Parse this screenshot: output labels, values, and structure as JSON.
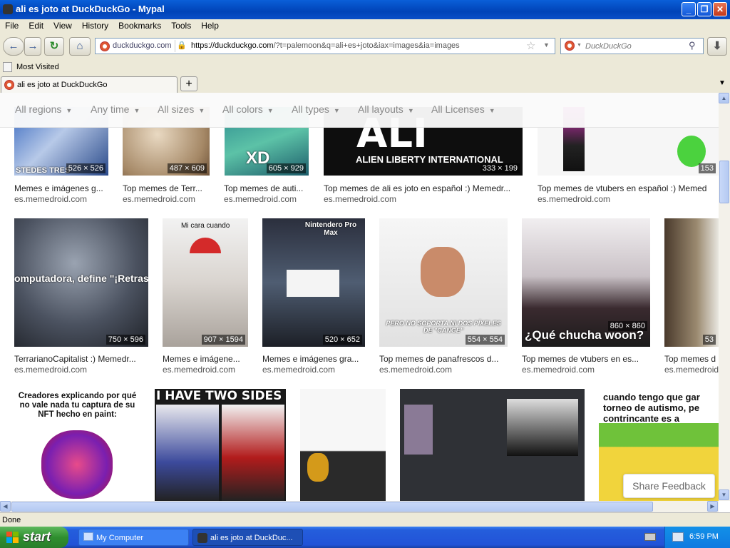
{
  "window": {
    "title": "ali es joto at DuckDuckGo - Mypal"
  },
  "menu": [
    "File",
    "Edit",
    "View",
    "History",
    "Bookmarks",
    "Tools",
    "Help"
  ],
  "nav": {
    "site_identity": "duckduckgo.com",
    "url_host": "https://duckduckgo.com",
    "url_rest": "/?t=palemoon&q=ali+es+joto&iax=images&ia=images",
    "search_placeholder": "DuckDuckGo"
  },
  "bookmarks": {
    "most_visited": "Most Visited"
  },
  "tab": {
    "title": "ali es joto at DuckDuckGo",
    "new_tab": "+"
  },
  "filters": [
    "All regions",
    "Any time",
    "All sizes",
    "All colors",
    "All types",
    "All layouts",
    "All Licenses"
  ],
  "results": {
    "row1": [
      {
        "caption": "Memes e imágenes g...",
        "source": "es.memedroid.com",
        "dims": "526 × 526",
        "overlay": "STEDES TRES"
      },
      {
        "caption": "Top memes de Terr...",
        "source": "es.memedroid.com",
        "dims": "487 × 609"
      },
      {
        "caption": "Top memes de auti...",
        "source": "es.memedroid.com",
        "dims": "605 × 929",
        "overlay": "XD"
      },
      {
        "caption": "Top memes de ali es joto en español :) Memedr...",
        "source": "es.memedroid.com",
        "dims": "333 × 199",
        "overlay": "ALI",
        "overlay2": "ALIEN LIBERTY INTERNATIONAL"
      },
      {
        "caption": "Top memes de vtubers en español :) Memed",
        "source": "es.memedroid.com",
        "dims": "153"
      }
    ],
    "row2": [
      {
        "caption": "TerrarianoCapitalist :) Memedr...",
        "source": "es.memedroid.com",
        "dims": "750 × 596",
        "overlay": "omputadora, define \"¡Retraso"
      },
      {
        "caption": "Memes e imágene...",
        "source": "es.memedroid.com",
        "dims": "907 × 1594",
        "overlay": "Mi cara cuando"
      },
      {
        "caption": "Memes e imágenes gra...",
        "source": "es.memedroid.com",
        "dims": "520 × 652",
        "overlay": "Nintendero Pro Max"
      },
      {
        "caption": "Top memes de panafrescos d...",
        "source": "es.memedroid.com",
        "dims": "554 × 554",
        "overlay": "PERO NO SOPORTA NI DOS PÍXELES DE \"CANGE\""
      },
      {
        "caption": "Top memes de vtubers en es...",
        "source": "es.memedroid.com",
        "dims": "860 × 860",
        "overlay": "¿Qué chucha woon?"
      },
      {
        "caption": "Top memes d",
        "source": "es.memedroid.com",
        "dims": "53"
      }
    ],
    "row3": [
      {
        "overlay": "Creadores explicando por qué no vale nada tu captura de su NFT hecho en paint:"
      },
      {
        "overlay": "I HAVE TWO SIDES"
      },
      {
        "overlay": ""
      },
      {
        "overlay": ""
      },
      {
        "overlay": "cuando tengo que gar torneo de autismo, pe contrincante es a"
      }
    ]
  },
  "feedback": "Share Feedback",
  "status": "Done",
  "taskbar": {
    "start": "start",
    "tasks": [
      "My Computer",
      "ali es joto at DuckDuc..."
    ],
    "clock": "6:59 PM"
  }
}
